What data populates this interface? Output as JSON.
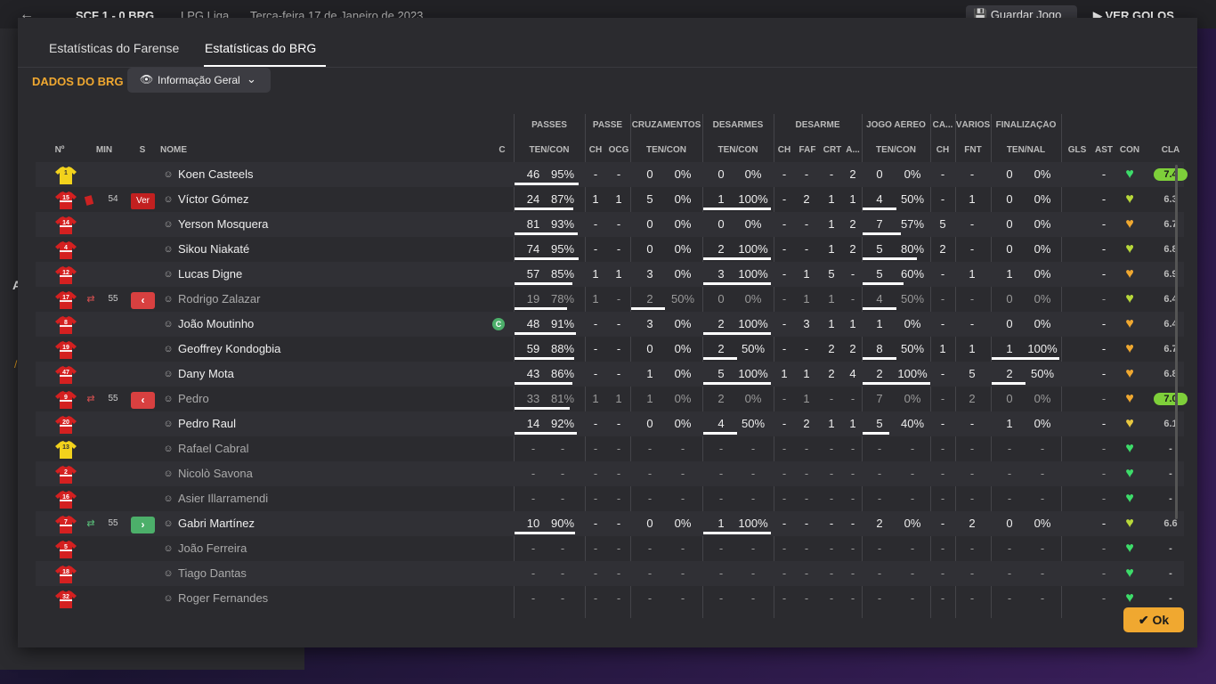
{
  "topbar": {
    "score": "SCF  1 - 0  BRG",
    "league": "LPG Liga",
    "date": "Terça-feira 17 de Janeiro de 2023",
    "save_label": "Guardar Jogo",
    "goals_label": "VER GOLOS"
  },
  "tabs": [
    {
      "label": "Estatísticas do Farense"
    },
    {
      "label": "Estatísticas do BRG"
    }
  ],
  "section_title": "DADOS DO BRG",
  "dropdown": {
    "selected": "Informação Geral"
  },
  "ok_label": "Ok",
  "colors": {
    "accent": "#f0a830",
    "rating_high": "#7ecf3a",
    "sub_out": "#d84040",
    "sub_in": "#4caf6a"
  },
  "group_headers": [
    "PASSES",
    "PASSE",
    "CRUZAMENTOS",
    "DESARMES",
    "DESARME",
    "JOGO AÉREO",
    "CA...",
    "VÁRIOS",
    "FINALIZAÇÃO"
  ],
  "sub_headers": [
    "Nº",
    "MIN",
    "S",
    "NOME",
    "C",
    "TEN/CON",
    "CH",
    "OCG",
    "TEN/CON",
    "TEN/CON",
    "CH",
    "FAF",
    "CRT",
    "A...",
    "TEN/CON",
    "CH",
    "FNT",
    "TEN/NAL",
    "GLS",
    "AST",
    "CON",
    "CLA"
  ],
  "players": [
    {
      "num": "1",
      "gk": true,
      "name": "Koen Casteels",
      "dim": false,
      "sub": "",
      "min": "",
      "card": false,
      "capt": false,
      "pass": [
        "46",
        "95%"
      ],
      "pass_fill": 0.95,
      "passe": [
        "-",
        "-"
      ],
      "cruz": [
        "0",
        "0%"
      ],
      "cruz_fill": 0,
      "des": [
        "0",
        "0%"
      ],
      "des_fill": 0,
      "desarme": [
        "-",
        "-",
        "-",
        "2"
      ],
      "aer": [
        "0",
        "0%"
      ],
      "aer_fill": 0,
      "ca": "-",
      "fnt": "-",
      "fin": [
        "0",
        "0%"
      ],
      "fin_fill": 0,
      "gls": "",
      "ast": "-",
      "con": "green",
      "cla": "7.4",
      "cla_hi": true
    },
    {
      "num": "15",
      "gk": false,
      "name": "Víctor Gómez",
      "dim": false,
      "sub": "",
      "min": "54",
      "card": true,
      "capt": false,
      "pass": [
        "24",
        "87%"
      ],
      "pass_fill": 0.87,
      "passe": [
        "1",
        "1"
      ],
      "cruz": [
        "5",
        "0%"
      ],
      "cruz_fill": 0,
      "des": [
        "1",
        "100%"
      ],
      "des_fill": 1,
      "desarme": [
        "-",
        "2",
        "1",
        "1"
      ],
      "aer": [
        "4",
        "50%"
      ],
      "aer_fill": 0.5,
      "ca": "-",
      "fnt": "1",
      "fin": [
        "0",
        "0%"
      ],
      "fin_fill": 0,
      "gls": "",
      "ast": "-",
      "con": "yellowgreen",
      "cla": "6.3",
      "cla_hi": false
    },
    {
      "num": "14",
      "gk": false,
      "name": "Yerson Mosquera",
      "dim": false,
      "sub": "",
      "min": "",
      "card": false,
      "capt": false,
      "pass": [
        "81",
        "93%"
      ],
      "pass_fill": 0.93,
      "passe": [
        "-",
        "-"
      ],
      "cruz": [
        "0",
        "0%"
      ],
      "cruz_fill": 0,
      "des": [
        "0",
        "0%"
      ],
      "des_fill": 0,
      "desarme": [
        "-",
        "-",
        "1",
        "2"
      ],
      "aer": [
        "7",
        "57%"
      ],
      "aer_fill": 0.57,
      "ca": "5",
      "fnt": "-",
      "fin": [
        "0",
        "0%"
      ],
      "fin_fill": 0,
      "gls": "",
      "ast": "-",
      "con": "orange",
      "cla": "6.7",
      "cla_hi": false
    },
    {
      "num": "4",
      "gk": false,
      "name": "Sikou Niakaté",
      "dim": false,
      "sub": "",
      "min": "",
      "card": false,
      "capt": false,
      "pass": [
        "74",
        "95%"
      ],
      "pass_fill": 0.95,
      "passe": [
        "-",
        "-"
      ],
      "cruz": [
        "0",
        "0%"
      ],
      "cruz_fill": 0,
      "des": [
        "2",
        "100%"
      ],
      "des_fill": 1,
      "desarme": [
        "-",
        "-",
        "1",
        "2"
      ],
      "aer": [
        "5",
        "80%"
      ],
      "aer_fill": 0.8,
      "ca": "2",
      "fnt": "-",
      "fin": [
        "0",
        "0%"
      ],
      "fin_fill": 0,
      "gls": "",
      "ast": "-",
      "con": "yellowgreen",
      "cla": "6.8",
      "cla_hi": false
    },
    {
      "num": "12",
      "gk": false,
      "name": "Lucas Digne",
      "dim": false,
      "sub": "",
      "min": "",
      "card": false,
      "capt": false,
      "pass": [
        "57",
        "85%"
      ],
      "pass_fill": 0.85,
      "passe": [
        "1",
        "1"
      ],
      "cruz": [
        "3",
        "0%"
      ],
      "cruz_fill": 0,
      "des": [
        "3",
        "100%"
      ],
      "des_fill": 1,
      "desarme": [
        "-",
        "1",
        "5",
        "-"
      ],
      "aer": [
        "5",
        "60%"
      ],
      "aer_fill": 0.6,
      "ca": "-",
      "fnt": "1",
      "fin": [
        "1",
        "0%"
      ],
      "fin_fill": 0,
      "gls": "",
      "ast": "-",
      "con": "orange",
      "cla": "6.9",
      "cla_hi": false
    },
    {
      "num": "17",
      "gk": false,
      "name": "Rodrigo Zalazar",
      "dim": true,
      "sub": "out",
      "min": "55",
      "card": false,
      "capt": false,
      "pass": [
        "19",
        "78%"
      ],
      "pass_fill": 0.78,
      "passe": [
        "1",
        "-"
      ],
      "cruz": [
        "2",
        "50%"
      ],
      "cruz_fill": 0.5,
      "des": [
        "0",
        "0%"
      ],
      "des_fill": 0,
      "desarme": [
        "-",
        "1",
        "1",
        "-"
      ],
      "aer": [
        "4",
        "50%"
      ],
      "aer_fill": 0.5,
      "ca": "-",
      "fnt": "-",
      "fin": [
        "0",
        "0%"
      ],
      "fin_fill": 0,
      "gls": "",
      "ast": "-",
      "con": "yellowgreen",
      "cla": "6.4",
      "cla_hi": false
    },
    {
      "num": "8",
      "gk": false,
      "name": "João Moutinho",
      "dim": false,
      "sub": "",
      "min": "",
      "card": false,
      "capt": true,
      "pass": [
        "48",
        "91%"
      ],
      "pass_fill": 0.91,
      "passe": [
        "-",
        "-"
      ],
      "cruz": [
        "3",
        "0%"
      ],
      "cruz_fill": 0,
      "des": [
        "2",
        "100%"
      ],
      "des_fill": 1,
      "desarme": [
        "-",
        "3",
        "1",
        "1"
      ],
      "aer": [
        "1",
        "0%"
      ],
      "aer_fill": 0,
      "ca": "-",
      "fnt": "-",
      "fin": [
        "0",
        "0%"
      ],
      "fin_fill": 0,
      "gls": "",
      "ast": "-",
      "con": "orange",
      "cla": "6.4",
      "cla_hi": false
    },
    {
      "num": "19",
      "gk": false,
      "name": "Geoffrey Kondogbia",
      "dim": false,
      "sub": "",
      "min": "",
      "card": false,
      "capt": false,
      "pass": [
        "59",
        "88%"
      ],
      "pass_fill": 0.88,
      "passe": [
        "-",
        "-"
      ],
      "cruz": [
        "0",
        "0%"
      ],
      "cruz_fill": 0,
      "des": [
        "2",
        "50%"
      ],
      "des_fill": 0.5,
      "desarme": [
        "-",
        "-",
        "2",
        "2"
      ],
      "aer": [
        "8",
        "50%"
      ],
      "aer_fill": 0.5,
      "ca": "1",
      "fnt": "1",
      "fin": [
        "1",
        "100%"
      ],
      "fin_fill": 1,
      "gls": "",
      "ast": "-",
      "con": "orange",
      "cla": "6.7",
      "cla_hi": false
    },
    {
      "num": "47",
      "gk": false,
      "name": "Dany Mota",
      "dim": false,
      "sub": "",
      "min": "",
      "card": false,
      "capt": false,
      "pass": [
        "43",
        "86%"
      ],
      "pass_fill": 0.86,
      "passe": [
        "-",
        "-"
      ],
      "cruz": [
        "1",
        "0%"
      ],
      "cruz_fill": 0,
      "des": [
        "5",
        "100%"
      ],
      "des_fill": 1,
      "desarme": [
        "1",
        "1",
        "2",
        "4"
      ],
      "aer": [
        "2",
        "100%"
      ],
      "aer_fill": 1,
      "ca": "-",
      "fnt": "5",
      "fin": [
        "2",
        "50%"
      ],
      "fin_fill": 0.5,
      "gls": "",
      "ast": "-",
      "con": "orange",
      "cla": "6.8",
      "cla_hi": false
    },
    {
      "num": "9",
      "gk": false,
      "name": "Pedro",
      "dim": true,
      "sub": "out",
      "min": "55",
      "card": false,
      "capt": false,
      "pass": [
        "33",
        "81%"
      ],
      "pass_fill": 0.81,
      "passe": [
        "1",
        "1"
      ],
      "cruz": [
        "1",
        "0%"
      ],
      "cruz_fill": 0,
      "des": [
        "2",
        "0%"
      ],
      "des_fill": 0,
      "desarme": [
        "-",
        "1",
        "-",
        "-"
      ],
      "aer": [
        "7",
        "0%"
      ],
      "aer_fill": 0,
      "ca": "-",
      "fnt": "2",
      "fin": [
        "0",
        "0%"
      ],
      "fin_fill": 0,
      "gls": "",
      "ast": "-",
      "con": "orange",
      "cla": "7.0",
      "cla_hi": true
    },
    {
      "num": "20",
      "gk": false,
      "name": "Pedro Raul",
      "dim": false,
      "sub": "",
      "min": "",
      "card": false,
      "capt": false,
      "pass": [
        "14",
        "92%"
      ],
      "pass_fill": 0.92,
      "passe": [
        "-",
        "-"
      ],
      "cruz": [
        "0",
        "0%"
      ],
      "cruz_fill": 0,
      "des": [
        "4",
        "50%"
      ],
      "des_fill": 0.5,
      "desarme": [
        "-",
        "2",
        "1",
        "1"
      ],
      "aer": [
        "5",
        "40%"
      ],
      "aer_fill": 0.4,
      "ca": "-",
      "fnt": "-",
      "fin": [
        "1",
        "0%"
      ],
      "fin_fill": 0,
      "gls": "",
      "ast": "-",
      "con": "yellow",
      "cla": "6.1",
      "cla_hi": false
    },
    {
      "num": "13",
      "gk": true,
      "name": "Rafael Cabral",
      "dim": true,
      "sub": "",
      "min": "",
      "card": false,
      "capt": false,
      "pass": [
        "-",
        "-"
      ],
      "pass_fill": 0,
      "passe": [
        "-",
        "-"
      ],
      "cruz": [
        "-",
        "-"
      ],
      "cruz_fill": 0,
      "des": [
        "-",
        "-"
      ],
      "des_fill": 0,
      "desarme": [
        "-",
        "-",
        "-",
        "-"
      ],
      "aer": [
        "-",
        "-"
      ],
      "aer_fill": 0,
      "ca": "-",
      "fnt": "-",
      "fin": [
        "-",
        "-"
      ],
      "fin_fill": 0,
      "gls": "",
      "ast": "-",
      "con": "green",
      "cla": "-",
      "cla_hi": false
    },
    {
      "num": "2",
      "gk": false,
      "name": "Nicolò Savona",
      "dim": true,
      "sub": "",
      "min": "",
      "card": false,
      "capt": false,
      "pass": [
        "-",
        "-"
      ],
      "pass_fill": 0,
      "passe": [
        "-",
        "-"
      ],
      "cruz": [
        "-",
        "-"
      ],
      "cruz_fill": 0,
      "des": [
        "-",
        "-"
      ],
      "des_fill": 0,
      "desarme": [
        "-",
        "-",
        "-",
        "-"
      ],
      "aer": [
        "-",
        "-"
      ],
      "aer_fill": 0,
      "ca": "-",
      "fnt": "-",
      "fin": [
        "-",
        "-"
      ],
      "fin_fill": 0,
      "gls": "",
      "ast": "-",
      "con": "green",
      "cla": "-",
      "cla_hi": false
    },
    {
      "num": "16",
      "gk": false,
      "name": "Asier Illarramendi",
      "dim": true,
      "sub": "",
      "min": "",
      "card": false,
      "capt": false,
      "pass": [
        "-",
        "-"
      ],
      "pass_fill": 0,
      "passe": [
        "-",
        "-"
      ],
      "cruz": [
        "-",
        "-"
      ],
      "cruz_fill": 0,
      "des": [
        "-",
        "-"
      ],
      "des_fill": 0,
      "desarme": [
        "-",
        "-",
        "-",
        "-"
      ],
      "aer": [
        "-",
        "-"
      ],
      "aer_fill": 0,
      "ca": "-",
      "fnt": "-",
      "fin": [
        "-",
        "-"
      ],
      "fin_fill": 0,
      "gls": "",
      "ast": "-",
      "con": "green",
      "cla": "-",
      "cla_hi": false
    },
    {
      "num": "7",
      "gk": false,
      "name": "Gabri Martínez",
      "dim": false,
      "sub": "in",
      "min": "55",
      "card": false,
      "capt": false,
      "pass": [
        "10",
        "90%"
      ],
      "pass_fill": 0.9,
      "passe": [
        "-",
        "-"
      ],
      "cruz": [
        "0",
        "0%"
      ],
      "cruz_fill": 0,
      "des": [
        "1",
        "100%"
      ],
      "des_fill": 1,
      "desarme": [
        "-",
        "-",
        "-",
        "-"
      ],
      "aer": [
        "2",
        "0%"
      ],
      "aer_fill": 0,
      "ca": "-",
      "fnt": "2",
      "fin": [
        "0",
        "0%"
      ],
      "fin_fill": 0,
      "gls": "",
      "ast": "-",
      "con": "yellowgreen",
      "cla": "6.6",
      "cla_hi": false
    },
    {
      "num": "5",
      "gk": false,
      "name": "João Ferreira",
      "dim": true,
      "sub": "",
      "min": "",
      "card": false,
      "capt": false,
      "pass": [
        "-",
        "-"
      ],
      "pass_fill": 0,
      "passe": [
        "-",
        "-"
      ],
      "cruz": [
        "-",
        "-"
      ],
      "cruz_fill": 0,
      "des": [
        "-",
        "-"
      ],
      "des_fill": 0,
      "desarme": [
        "-",
        "-",
        "-",
        "-"
      ],
      "aer": [
        "-",
        "-"
      ],
      "aer_fill": 0,
      "ca": "-",
      "fnt": "-",
      "fin": [
        "-",
        "-"
      ],
      "fin_fill": 0,
      "gls": "",
      "ast": "-",
      "con": "green",
      "cla": "-",
      "cla_hi": false
    },
    {
      "num": "18",
      "gk": false,
      "name": "Tiago Dantas",
      "dim": true,
      "sub": "",
      "min": "",
      "card": false,
      "capt": false,
      "pass": [
        "-",
        "-"
      ],
      "pass_fill": 0,
      "passe": [
        "-",
        "-"
      ],
      "cruz": [
        "-",
        "-"
      ],
      "cruz_fill": 0,
      "des": [
        "-",
        "-"
      ],
      "des_fill": 0,
      "desarme": [
        "-",
        "-",
        "-",
        "-"
      ],
      "aer": [
        "-",
        "-"
      ],
      "aer_fill": 0,
      "ca": "-",
      "fnt": "-",
      "fin": [
        "-",
        "-"
      ],
      "fin_fill": 0,
      "gls": "",
      "ast": "-",
      "con": "green",
      "cla": "-",
      "cla_hi": false
    },
    {
      "num": "32",
      "gk": false,
      "name": "Roger Fernandes",
      "dim": true,
      "sub": "",
      "min": "",
      "card": false,
      "capt": false,
      "pass": [
        "-",
        "-"
      ],
      "pass_fill": 0,
      "passe": [
        "-",
        "-"
      ],
      "cruz": [
        "-",
        "-"
      ],
      "cruz_fill": 0,
      "des": [
        "-",
        "-"
      ],
      "des_fill": 0,
      "desarme": [
        "-",
        "-",
        "-",
        "-"
      ],
      "aer": [
        "-",
        "-"
      ],
      "aer_fill": 0,
      "ca": "-",
      "fnt": "-",
      "fin": [
        "-",
        "-"
      ],
      "fin_fill": 0,
      "gls": "",
      "ast": "-",
      "con": "green",
      "cla": "-",
      "cla_hi": false
    }
  ]
}
